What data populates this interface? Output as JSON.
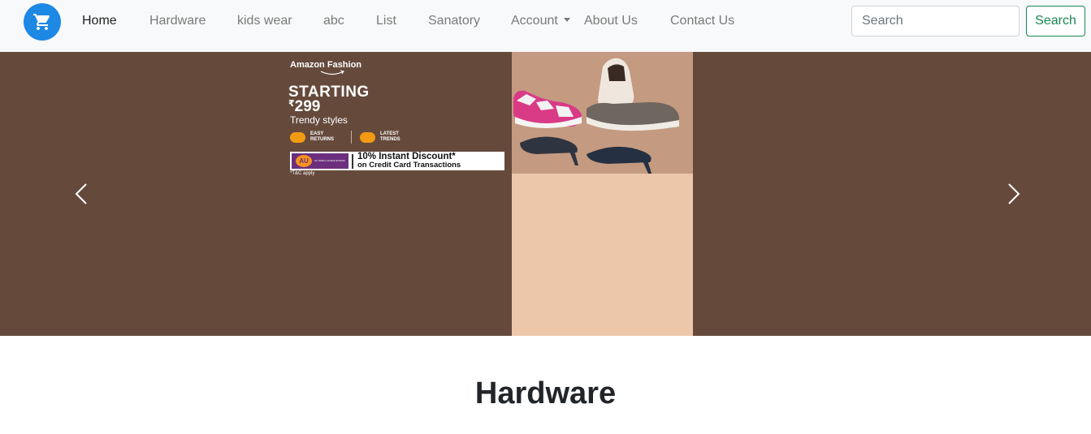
{
  "navbar": {
    "logo_icon": "shopping-cart-icon",
    "brand_color": "#1e88e5",
    "links": [
      {
        "label": "Home",
        "active": true
      },
      {
        "label": "Hardware"
      },
      {
        "label": "kids wear"
      },
      {
        "label": "abc"
      },
      {
        "label": "List"
      },
      {
        "label": "Sanatory"
      },
      {
        "label": "Account",
        "dropdown": true
      },
      {
        "label": "About Us"
      },
      {
        "label": "Contact Us"
      }
    ],
    "search_placeholder": "Search",
    "search_button": "Search",
    "search_button_color": "#198754"
  },
  "carousel": {
    "background": "#654a3c",
    "prev_icon": "chevron-left-icon",
    "next_icon": "chevron-right-icon",
    "banner": {
      "brand": "Amazon Fashion",
      "headline": "STARTING",
      "currency": "₹",
      "price": "299",
      "tagline": "Trendy styles",
      "feature_1": "EASY\nRETURNS",
      "feature_2": "LATEST\nTRENDS",
      "bank_logo": "AU",
      "bank_name": "AU SMALL FINANCE BANK",
      "offer_main": "10% Instant Discount*",
      "offer_sub": "on Credit Card Transactions",
      "terms": "*T&C apply"
    }
  },
  "section": {
    "title": "Hardware"
  }
}
